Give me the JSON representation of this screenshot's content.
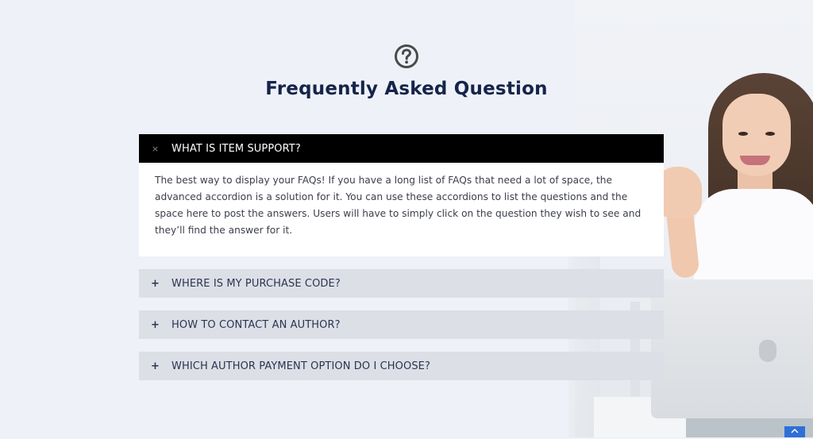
{
  "header": {
    "title": "Frequently Asked Question",
    "icon": "question-circle-icon"
  },
  "faq": {
    "items": [
      {
        "question": "WHAT IS ITEM SUPPORT?",
        "toggle": "×",
        "expanded": true,
        "answer": "The best way to display your FAQs! If you have a long list of FAQs that need a lot of space, the advanced accordion is a solution for it. You can use these accordions to list the questions and the space here to post the answers. Users will have to simply click on the question they wish to see and they’ll find the answer for it."
      },
      {
        "question": "WHERE IS MY PURCHASE CODE?",
        "toggle": "+",
        "expanded": false
      },
      {
        "question": "HOW TO CONTACT AN AUTHOR?",
        "toggle": "+",
        "expanded": false
      },
      {
        "question": "WHICH AUTHOR PAYMENT OPTION DO I CHOOSE?",
        "toggle": "+",
        "expanded": false
      }
    ]
  },
  "colors": {
    "background": "#eef2f8",
    "title": "#16244a",
    "active_header": "#000000",
    "inactive_header": "#dcdfe6",
    "scroll_top": "#2f6fd6"
  },
  "scroll_top_icon": "chevron-up-icon"
}
